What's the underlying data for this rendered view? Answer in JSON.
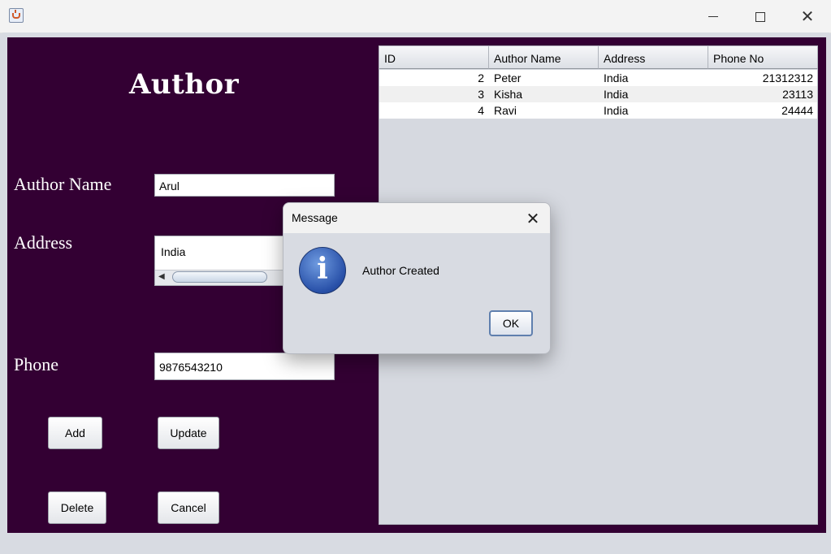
{
  "window": {
    "controls": {
      "minimize": "minimize",
      "maximize": "maximize",
      "close": "close"
    }
  },
  "form": {
    "heading": "Author",
    "name_label": "Author Name",
    "name_value": "Arul",
    "address_label": "Address",
    "address_value": "India",
    "phone_label": "Phone",
    "phone_value": "9876543210",
    "buttons": {
      "add": "Add",
      "update": "Update",
      "delete": "Delete",
      "cancel": "Cancel"
    }
  },
  "table": {
    "columns": [
      "ID",
      "Author Name",
      "Address",
      "Phone No"
    ],
    "rows": [
      {
        "id": "2",
        "name": "Peter",
        "address": "India",
        "phone": "21312312"
      },
      {
        "id": "3",
        "name": "Kisha",
        "address": "India",
        "phone": "23113"
      },
      {
        "id": "4",
        "name": "Ravi",
        "address": "India",
        "phone": "24444"
      }
    ]
  },
  "dialog": {
    "title": "Message",
    "message": "Author Created",
    "ok_label": "OK",
    "icon": "info-icon"
  },
  "colors": {
    "panel_bg": "#330033",
    "window_bg": "#d8dbe2",
    "dialog_icon": "#2850a8"
  }
}
